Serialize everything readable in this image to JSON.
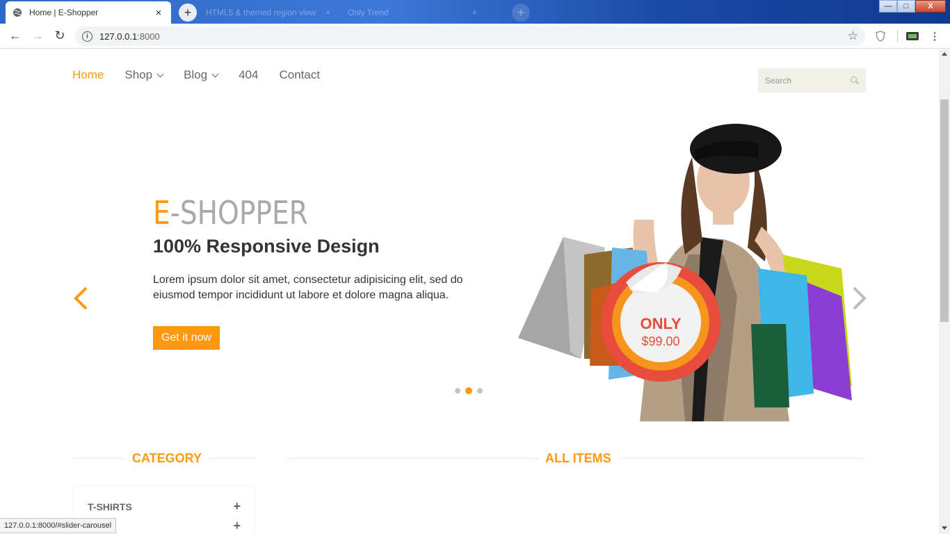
{
  "browser": {
    "tab_title": "Home | E-Shopper",
    "ghost_tab_1": "HTML5 & themed region view",
    "ghost_tab_2": "Only Trend",
    "url_host": "127.0.0.1",
    "url_port": ":8000",
    "status_url": "127.0.0.1:8000/#slider-carousel",
    "new_tab_symbol": "+",
    "close_symbol": "×"
  },
  "nav": {
    "home": "Home",
    "shop": "Shop",
    "blog": "Blog",
    "notfound": "404",
    "contact": "Contact"
  },
  "search": {
    "placeholder": "Search"
  },
  "hero": {
    "brand_first": "E",
    "brand_rest": "-SHOPPER",
    "heading": "100% Responsive Design",
    "text": "Lorem ipsum dolor sit amet, consectetur adipisicing elit, sed do eiusmod tempor incididunt ut labore et dolore magna aliqua.",
    "cta": "Get it now",
    "badge_title": "ONLY",
    "badge_price": "$99.00",
    "active_slide": 2,
    "slide_count": 3
  },
  "sections": {
    "category": "CATEGORY",
    "all_items": "ALL ITEMS"
  },
  "categories": [
    {
      "label": "T-SHIRTS",
      "icon": "+"
    },
    {
      "label": "",
      "icon": "+"
    }
  ],
  "colors": {
    "accent": "#fe980f",
    "text": "#363432",
    "badge_red": "#e74c3c"
  }
}
